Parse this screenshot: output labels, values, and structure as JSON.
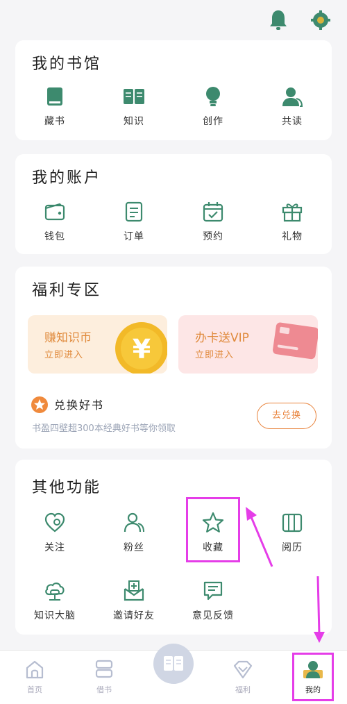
{
  "library": {
    "title": "我的书馆",
    "items": [
      {
        "label": "藏书",
        "icon": "book-icon"
      },
      {
        "label": "知识",
        "icon": "open-book-icon"
      },
      {
        "label": "创作",
        "icon": "lightbulb-icon"
      },
      {
        "label": "共读",
        "icon": "users-icon"
      }
    ]
  },
  "account": {
    "title": "我的账户",
    "items": [
      {
        "label": "钱包",
        "icon": "wallet-icon"
      },
      {
        "label": "订单",
        "icon": "order-icon"
      },
      {
        "label": "预约",
        "icon": "calendar-icon"
      },
      {
        "label": "礼物",
        "icon": "gift-icon"
      }
    ]
  },
  "welfare": {
    "title": "福利专区",
    "promo_coin": {
      "title": "赚知识币",
      "subtitle": "立即进入"
    },
    "promo_vip": {
      "title": "办卡送VIP",
      "subtitle": "立即进入"
    },
    "exchange": {
      "title": "兑换好书",
      "desc": "书盈四壁超300本经典好书等你领取",
      "button": "去兑换"
    }
  },
  "other": {
    "title": "其他功能",
    "items": [
      {
        "label": "关注",
        "icon": "heart-icon"
      },
      {
        "label": "粉丝",
        "icon": "fans-icon"
      },
      {
        "label": "收藏",
        "icon": "star-icon"
      },
      {
        "label": "阅历",
        "icon": "history-icon"
      },
      {
        "label": "知识大脑",
        "icon": "cloud-icon"
      },
      {
        "label": "邀请好友",
        "icon": "invite-icon"
      },
      {
        "label": "意见反馈",
        "icon": "feedback-icon"
      }
    ]
  },
  "nav": {
    "items": [
      {
        "label": "首页",
        "icon": "home-icon"
      },
      {
        "label": "借书",
        "icon": "borrow-icon"
      },
      {
        "label": "",
        "icon": "reader-icon"
      },
      {
        "label": "福利",
        "icon": "diamond-icon"
      },
      {
        "label": "我的",
        "icon": "profile-icon"
      }
    ]
  },
  "colors": {
    "accent": "#3d8a6e",
    "orange": "#e8823a",
    "highlight": "#e53de8"
  }
}
